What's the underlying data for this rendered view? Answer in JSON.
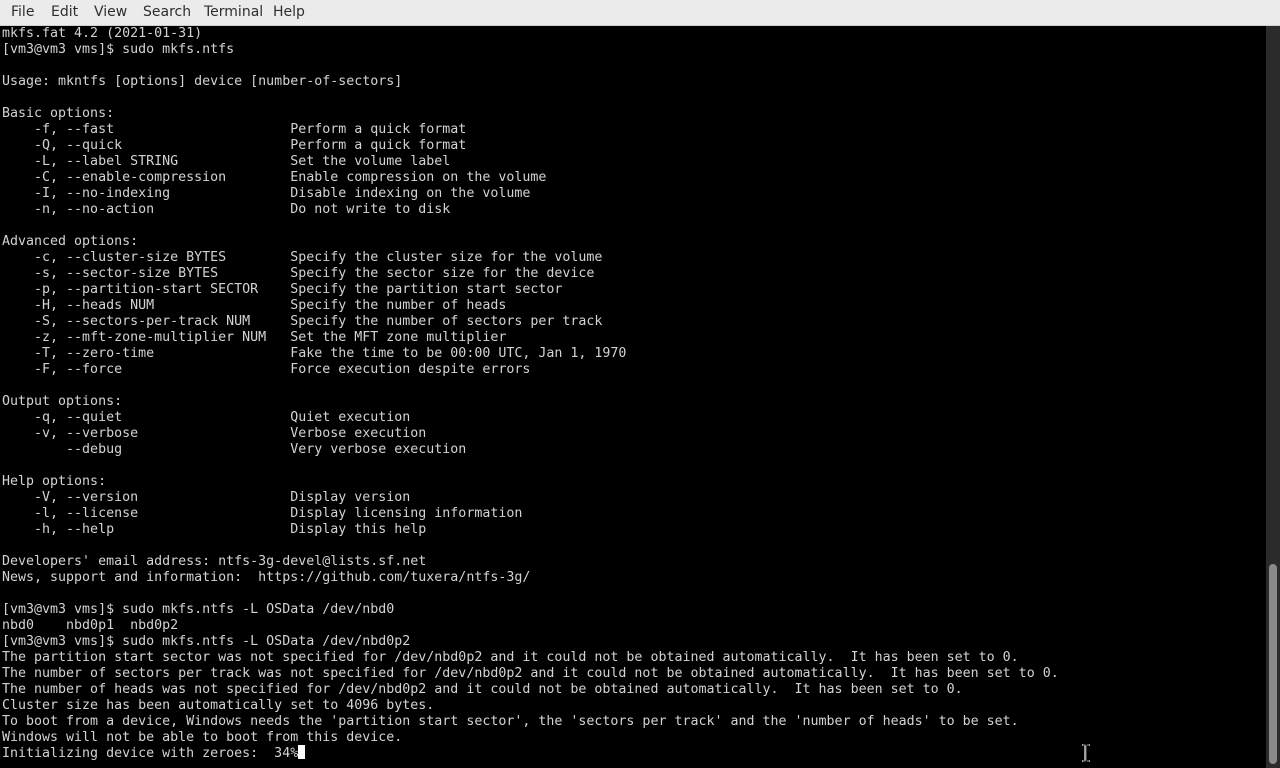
{
  "menubar": {
    "items": [
      "File",
      "Edit",
      "View",
      "Search",
      "Terminal",
      "Help"
    ]
  },
  "terminal": {
    "lines": [
      "mkfs.fat 4.2 (2021-01-31)",
      "[vm3@vm3 vms]$ sudo mkfs.ntfs",
      "",
      "Usage: mkntfs [options] device [number-of-sectors]",
      "",
      "Basic options:",
      "    -f, --fast                      Perform a quick format",
      "    -Q, --quick                     Perform a quick format",
      "    -L, --label STRING              Set the volume label",
      "    -C, --enable-compression        Enable compression on the volume",
      "    -I, --no-indexing               Disable indexing on the volume",
      "    -n, --no-action                 Do not write to disk",
      "",
      "Advanced options:",
      "    -c, --cluster-size BYTES        Specify the cluster size for the volume",
      "    -s, --sector-size BYTES         Specify the sector size for the device",
      "    -p, --partition-start SECTOR    Specify the partition start sector",
      "    -H, --heads NUM                 Specify the number of heads",
      "    -S, --sectors-per-track NUM     Specify the number of sectors per track",
      "    -z, --mft-zone-multiplier NUM   Set the MFT zone multiplier",
      "    -T, --zero-time                 Fake the time to be 00:00 UTC, Jan 1, 1970",
      "    -F, --force                     Force execution despite errors",
      "",
      "Output options:",
      "    -q, --quiet                     Quiet execution",
      "    -v, --verbose                   Verbose execution",
      "        --debug                     Very verbose execution",
      "",
      "Help options:",
      "    -V, --version                   Display version",
      "    -l, --license                   Display licensing information",
      "    -h, --help                      Display this help",
      "",
      "Developers' email address: ntfs-3g-devel@lists.sf.net",
      "News, support and information:  https://github.com/tuxera/ntfs-3g/",
      "",
      "[vm3@vm3 vms]$ sudo mkfs.ntfs -L OSData /dev/nbd0",
      "nbd0    nbd0p1  nbd0p2",
      "[vm3@vm3 vms]$ sudo mkfs.ntfs -L OSData /dev/nbd0p2",
      "The partition start sector was not specified for /dev/nbd0p2 and it could not be obtained automatically.  It has been set to 0.",
      "The number of sectors per track was not specified for /dev/nbd0p2 and it could not be obtained automatically.  It has been set to 0.",
      "The number of heads was not specified for /dev/nbd0p2 and it could not be obtained automatically.  It has been set to 0.",
      "Cluster size has been automatically set to 4096 bytes.",
      "To boot from a device, Windows needs the 'partition start sector', the 'sectors per track' and the 'number of heads' to be set.",
      "Windows will not be able to boot from this device."
    ],
    "progress_line": "Initializing device with zeroes:  34%"
  },
  "icons": {
    "cursor": "text-cursor-block-icon",
    "pointer": "ibeam-pointer-icon"
  },
  "colors": {
    "background": "#000000",
    "foreground": "#d3d3d3",
    "menubar": "#ebebeb"
  }
}
